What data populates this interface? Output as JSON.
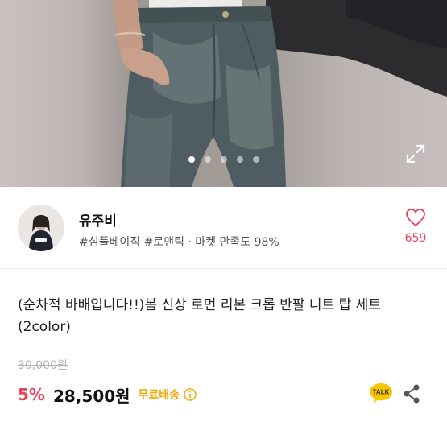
{
  "hero": {
    "image_subject": "jeans-photo",
    "slide_count": 5,
    "active_slide": 1
  },
  "seller": {
    "name": "유주비",
    "tags": "#심플베이직 #로맨틱 · 마켓 만족도 98%",
    "likes": "659"
  },
  "product": {
    "title": "(순차적 바배입니다!!)봄 신상 로먼 리본 크롭 반팔 니트 탑 세트 (2color)",
    "original_price": "30,000원",
    "discount": "5%",
    "price": "28,500원",
    "shipping": "무료배송",
    "talk_label": "TALK"
  },
  "colors": {
    "accent_red": "#e8455a",
    "shipping_orange": "#f2a600",
    "talk_yellow": "#f8c700"
  },
  "icons": [
    "expand-icon",
    "heart-icon",
    "info-icon",
    "kakao-talk-icon",
    "share-icon"
  ]
}
